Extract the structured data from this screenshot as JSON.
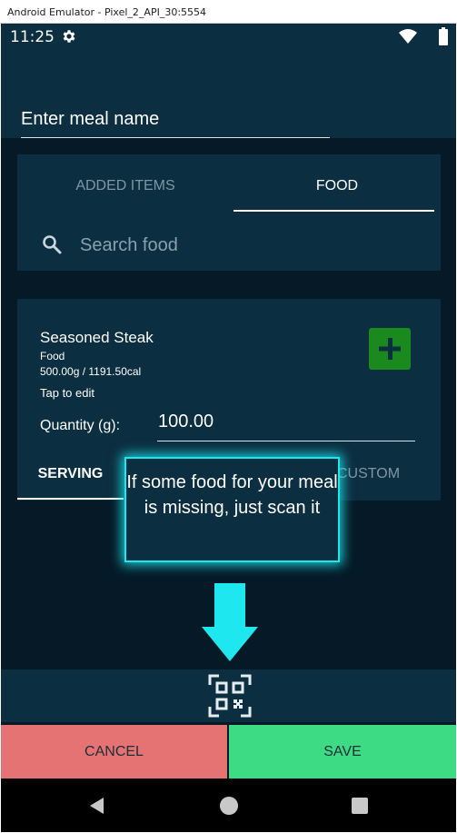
{
  "window": {
    "title": "Android Emulator - Pixel_2_API_30:5554"
  },
  "status_bar": {
    "time": "11:25",
    "icons": [
      "gear-icon",
      "wifi-icon",
      "battery-icon"
    ]
  },
  "meal": {
    "name_placeholder": "Enter meal name"
  },
  "tabs": [
    {
      "label": "ADDED ITEMS",
      "selected": false
    },
    {
      "label": "FOOD",
      "selected": true
    }
  ],
  "search": {
    "placeholder": "Search food",
    "icon": "search-icon"
  },
  "food_item": {
    "name": "Seasoned Steak",
    "type": "Food",
    "info": "500.00g / 1191.50cal",
    "edit_hint": "Tap to edit",
    "quantity_label": "Quantity (g):",
    "quantity_value": "100.00",
    "unit_tabs": [
      {
        "label": "SERVING",
        "selected": true
      },
      {
        "label": "CUSTOM",
        "selected": false
      }
    ]
  },
  "tooltip": {
    "text": "If some food for your meal is missing, just scan it"
  },
  "actions": {
    "cancel_label": "CANCEL",
    "save_label": "SAVE"
  },
  "colors": {
    "background": "#051a26",
    "surface": "#0b2e40",
    "cancel": "#e57373",
    "save": "#3ddc84",
    "add_button": "#1a8a1e",
    "tooltip_glow": "#1ee7ef"
  }
}
